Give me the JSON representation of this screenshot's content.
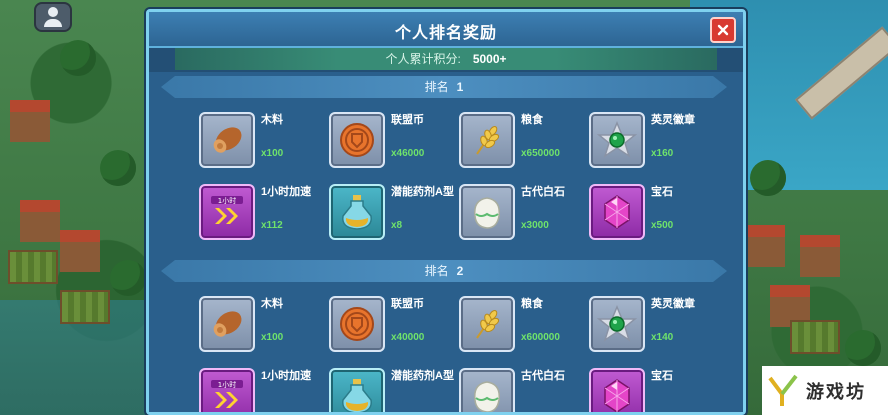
{
  "dialog": {
    "title": "个人排名奖励",
    "score_label": "个人累计积分:",
    "score_value": "5000+"
  },
  "ranks": [
    {
      "label": "排名",
      "number": "1",
      "items": [
        {
          "name": "木料",
          "qty": "x100",
          "icon": "wood-log-icon"
        },
        {
          "name": "联盟币",
          "qty": "x46000",
          "icon": "alliance-coin-icon"
        },
        {
          "name": "粮食",
          "qty": "x650000",
          "icon": "wheat-icon"
        },
        {
          "name": "英灵徽章",
          "qty": "x160",
          "icon": "hero-badge-icon"
        },
        {
          "name": "1小时加速",
          "qty": "x112",
          "icon": "speedup-1h-icon",
          "badge": "1小时"
        },
        {
          "name": "潜能药剂A型",
          "qty": "x8",
          "icon": "potion-icon"
        },
        {
          "name": "古代白石",
          "qty": "x3000",
          "icon": "white-stone-icon"
        },
        {
          "name": "宝石",
          "qty": "x500",
          "icon": "gem-icon"
        }
      ]
    },
    {
      "label": "排名",
      "number": "2",
      "items": [
        {
          "name": "木料",
          "qty": "x100",
          "icon": "wood-log-icon"
        },
        {
          "name": "联盟币",
          "qty": "x40000",
          "icon": "alliance-coin-icon"
        },
        {
          "name": "粮食",
          "qty": "x600000",
          "icon": "wheat-icon"
        },
        {
          "name": "英灵徽章",
          "qty": "x140",
          "icon": "hero-badge-icon"
        },
        {
          "name": "1小时加速",
          "qty": "",
          "icon": "speedup-1h-icon",
          "badge": "1小时"
        },
        {
          "name": "潜能药剂A型",
          "qty": "",
          "icon": "potion-icon"
        },
        {
          "name": "古代白石",
          "qty": "",
          "icon": "white-stone-icon"
        },
        {
          "name": "宝石",
          "qty": "",
          "icon": "gem-icon"
        }
      ]
    }
  ],
  "watermark": {
    "text": "游戏坊"
  },
  "colors": {
    "qty": "#6fe36b",
    "dialog_bg": "#234f75",
    "border": "#7fd1ef",
    "close": "#d83a32"
  }
}
